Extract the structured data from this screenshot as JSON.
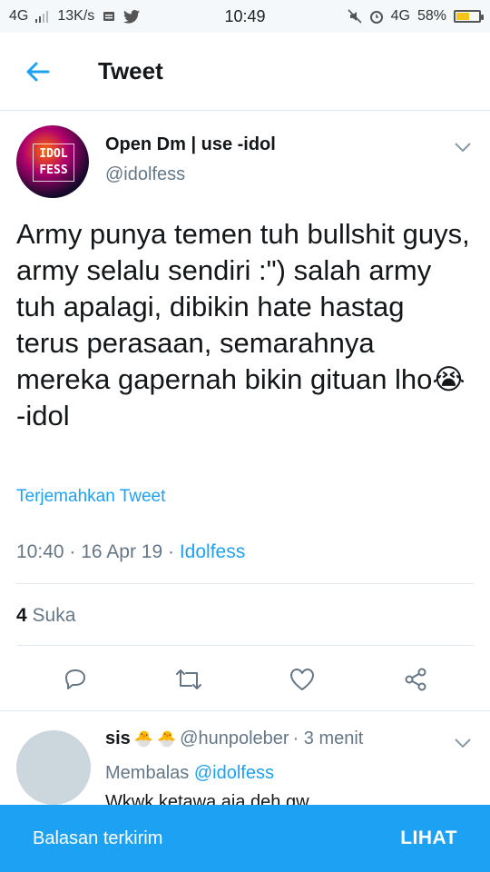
{
  "status_bar": {
    "network": "4G",
    "speed": "13K/s",
    "time": "10:49",
    "network_right": "4G",
    "battery_text": "58%",
    "battery_level": 0.58
  },
  "header": {
    "title": "Tweet",
    "icons": {
      "back": "arrow-left-icon"
    }
  },
  "tweet": {
    "author_name": "Open Dm | use -idol",
    "author_handle": "@idolfess",
    "avatar_text_1": "IDOL",
    "avatar_text_2": "FESS",
    "text": "Army punya temen tuh bullshit guys, army selalu sendiri :\") salah army tuh apalagi, dibikin hate hastag terus perasaan, semarahnya mereka gapernah bikin gituan lho😭 -idol",
    "translate_label": "Terjemahkan Tweet",
    "time": "10:40",
    "date": "16 Apr 19",
    "separator": "·",
    "source": "Idolfess",
    "likes_count": "4",
    "likes_label": "Suka"
  },
  "reply": {
    "name": "sis",
    "emoji": "🐣",
    "handle": "@hunpoleber",
    "time": "· 3 menit",
    "replying_label": "Membalas",
    "replying_to": "@idolfess",
    "text": "Wkwk ketawa aja deh gw"
  },
  "snackbar": {
    "message": "Balasan terkirim",
    "action": "LIHAT"
  },
  "colors": {
    "accent": "#1da1f2",
    "secondary_text": "#657786",
    "divider": "#e1e8ed"
  }
}
